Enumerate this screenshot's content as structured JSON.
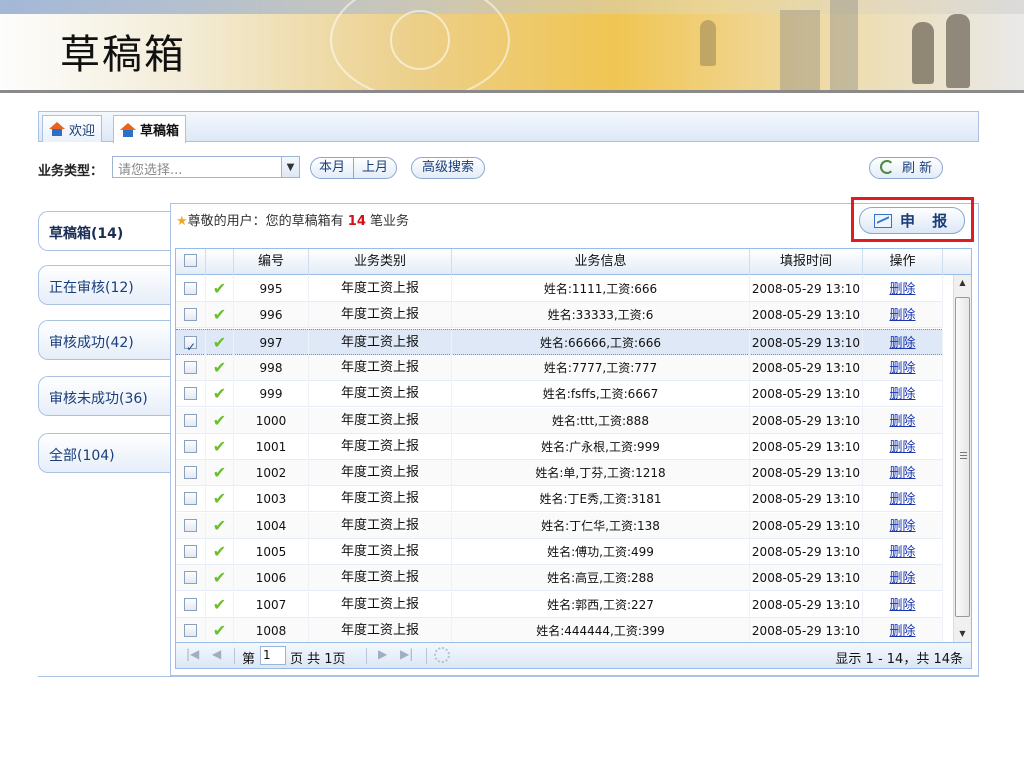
{
  "banner": {
    "title": "草稿箱"
  },
  "tabs": [
    {
      "label": "欢迎"
    },
    {
      "label": "草稿箱"
    }
  ],
  "filter": {
    "label": "业务类型：",
    "placeholder": "请您选择...",
    "this_month": "本月",
    "last_month": "上月",
    "advanced": "高级搜索",
    "refresh": "刷 新"
  },
  "nav": [
    {
      "label": "草稿箱(14)"
    },
    {
      "label": "正在审核(12)"
    },
    {
      "label": "审核成功(42)"
    },
    {
      "label": "审核未成功(36)"
    },
    {
      "label": "全部(104)"
    }
  ],
  "welcome": {
    "prefix": "尊敬的用户：您的草稿箱有 ",
    "count": "14",
    "suffix": " 笔业务"
  },
  "report_button": "申 报",
  "grid": {
    "headers": [
      "编号",
      "业务类别",
      "业务信息",
      "填报时间",
      "操作"
    ],
    "rows": [
      {
        "id": "995",
        "type": "年度工资上报",
        "info": "姓名:1111,工资:666",
        "time": "2008-05-29 13:10",
        "action": "删除",
        "checked": false
      },
      {
        "id": "996",
        "type": "年度工资上报",
        "info": "姓名:33333,工资:6",
        "time": "2008-05-29 13:10",
        "action": "删除",
        "checked": false
      },
      {
        "id": "997",
        "type": "年度工资上报",
        "info": "姓名:66666,工资:666",
        "time": "2008-05-29 13:10",
        "action": "删除",
        "checked": true
      },
      {
        "id": "998",
        "type": "年度工资上报",
        "info": "姓名:7777,工资:777",
        "time": "2008-05-29 13:10",
        "action": "删除",
        "checked": false
      },
      {
        "id": "999",
        "type": "年度工资上报",
        "info": "姓名:fsffs,工资:6667",
        "time": "2008-05-29 13:10",
        "action": "删除",
        "checked": false
      },
      {
        "id": "1000",
        "type": "年度工资上报",
        "info": "姓名:ttt,工资:888",
        "time": "2008-05-29 13:10",
        "action": "删除",
        "checked": false
      },
      {
        "id": "1001",
        "type": "年度工资上报",
        "info": "姓名:广永根,工资:999",
        "time": "2008-05-29 13:10",
        "action": "删除",
        "checked": false
      },
      {
        "id": "1002",
        "type": "年度工资上报",
        "info": "姓名:单,丁芬,工资:1218",
        "time": "2008-05-29 13:10",
        "action": "删除",
        "checked": false
      },
      {
        "id": "1003",
        "type": "年度工资上报",
        "info": "姓名:丁E秀,工资:3181",
        "time": "2008-05-29 13:10",
        "action": "删除",
        "checked": false
      },
      {
        "id": "1004",
        "type": "年度工资上报",
        "info": "姓名:丁仁华,工资:138",
        "time": "2008-05-29 13:10",
        "action": "删除",
        "checked": false
      },
      {
        "id": "1005",
        "type": "年度工资上报",
        "info": "姓名:傅功,工资:499",
        "time": "2008-05-29 13:10",
        "action": "删除",
        "checked": false
      },
      {
        "id": "1006",
        "type": "年度工资上报",
        "info": "姓名:高豆,工资:288",
        "time": "2008-05-29 13:10",
        "action": "删除",
        "checked": false
      },
      {
        "id": "1007",
        "type": "年度工资上报",
        "info": "姓名:郭西,工资:227",
        "time": "2008-05-29 13:10",
        "action": "删除",
        "checked": false
      },
      {
        "id": "1008",
        "type": "年度工资上报",
        "info": "姓名:444444,工资:399",
        "time": "2008-05-29 13:10",
        "action": "删除",
        "checked": false
      }
    ]
  },
  "pager": {
    "page_prefix": "第",
    "page_value": "1",
    "page_suffix": "页 共 1页",
    "summary": "显示 1 - 14，共 14条"
  },
  "colors": {
    "accent": "#1a3e7a",
    "highlight": "#e11b22",
    "count": "#d2101a",
    "tick": "#6bbf2a"
  }
}
